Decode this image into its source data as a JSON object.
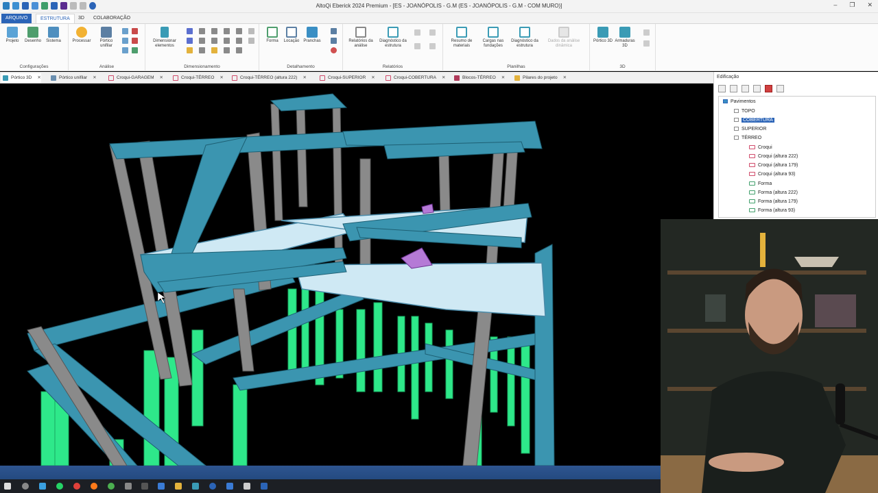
{
  "window": {
    "title": "AltoQi Eberick 2024 Premium - [ES - JOANÓPOLIS - G.M (ES - JOANÓPOLIS - G.M - COM MURO)]",
    "controls": [
      "–",
      "❐",
      "✕"
    ]
  },
  "ribbon_tabs": [
    "ARQUIVO",
    "ESTRUTURA",
    "3D",
    "COLABORAÇÃO"
  ],
  "ribbon": {
    "configuracoes": {
      "label": "Configurações",
      "buttons": [
        "Projeto",
        "Desenho",
        "Sistema"
      ]
    },
    "analise": {
      "label": "Análise",
      "buttons": [
        "Processar",
        "Pórtico unifilar"
      ]
    },
    "dimensionamento": {
      "label": "Dimensionamento",
      "buttons": [
        "Dimensionar elementos"
      ]
    },
    "detalhamento": {
      "label": "Detalhamento",
      "buttons": [
        "Forma",
        "Locação",
        "Pranchas"
      ]
    },
    "relatorios": {
      "label": "Relatórios",
      "buttons": [
        "Relatórios da análise",
        "Diagnóstico da estrutura"
      ]
    },
    "planilhas": {
      "label": "Planilhas",
      "buttons": [
        "Resumo de materiais",
        "Cargas nas fundações",
        "Diagnóstico da estrutura",
        "Dados da análise dinâmica"
      ]
    },
    "tresd": {
      "label": "3D",
      "buttons": [
        "Pórtico 3D",
        "Armaduras 3D"
      ]
    }
  },
  "doc_tabs": [
    "Pórtico 3D",
    "Pórtico unifilar",
    "Croqui-GARAGEM",
    "Croqui-TÉRREO",
    "Croqui-TÉRREO (altura 222)",
    "Croqui-SUPERIOR",
    "Croqui-COBERTURA",
    "Blocos-TÉRREO",
    "Pilares do projeto"
  ],
  "panel": {
    "title": "Edificação",
    "root": "Pavimentos",
    "floors": [
      "TOPO",
      "COBERTURA",
      "SUPERIOR",
      "TÉRREO"
    ],
    "selected": "COBERTURA",
    "terreo_children": [
      "Croqui",
      "Croqui (altura 222)",
      "Croqui (altura 179)",
      "Croqui (altura 93)",
      "Forma",
      "Forma (altura 222)",
      "Forma (altura 179)",
      "Forma (altura 93)"
    ]
  },
  "colors": {
    "beam": "#3b95b0",
    "column": "#8a8a8a",
    "slab": "#cfe9f4",
    "foundation": "#2ee88a",
    "accent": "#2b64b7"
  }
}
